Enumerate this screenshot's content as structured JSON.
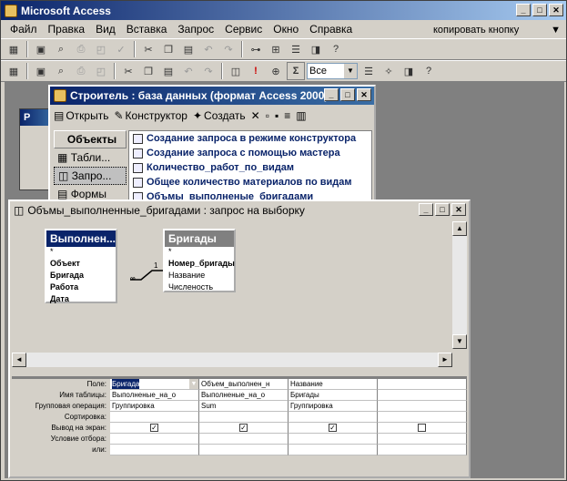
{
  "app": {
    "title": "Microsoft Access"
  },
  "menu": [
    "Файл",
    "Правка",
    "Вид",
    "Вставка",
    "Запрос",
    "Сервис",
    "Окно",
    "Справка"
  ],
  "help": {
    "text": "копировать кнопку"
  },
  "toolbar2": {
    "combo": "Все"
  },
  "db": {
    "title": "Строитель : база данных (формат Access 2000)",
    "open": "Открыть",
    "design": "Конструктор",
    "create": "Создать",
    "side_header": "Объекты",
    "side_items": [
      "Табли...",
      "Запро...",
      "Формы"
    ],
    "queries": [
      "Создание запроса в режиме конструктора",
      "Создание запроса с помощью мастера",
      "Количество_работ_по_видам",
      "Общее количество материалов по видам",
      "Объмы_выполненые_бригадами"
    ]
  },
  "behind": {
    "title": "Р"
  },
  "query": {
    "title": "Объмы_выполненные_бригадами : запрос на выборку",
    "t1": {
      "name": "Выполнен...",
      "fields": [
        "*",
        "Объект",
        "Бригада",
        "Работа",
        "Дата"
      ]
    },
    "t2": {
      "name": "Бригады",
      "fields": [
        "*",
        "Номер_бригады",
        "Название",
        "Численость"
      ]
    },
    "rel_one": "1",
    "rel_many": "∞",
    "grid_labels": [
      "Поле:",
      "Имя таблицы:",
      "Групповая операция:",
      "Сортировка:",
      "Вывод на экран:",
      "Условие отбора:",
      "или:"
    ],
    "cols": [
      {
        "field": "Бригада",
        "table": "Выполненые_на_о",
        "group": "Группировка",
        "show": true
      },
      {
        "field": "Объем_выполнен_н",
        "table": "Выполненые_на_о",
        "group": "Sum",
        "show": true
      },
      {
        "field": "Название",
        "table": "Бригады",
        "group": "Группировка",
        "show": true
      },
      {
        "field": "",
        "table": "",
        "group": "",
        "show": false
      }
    ]
  }
}
